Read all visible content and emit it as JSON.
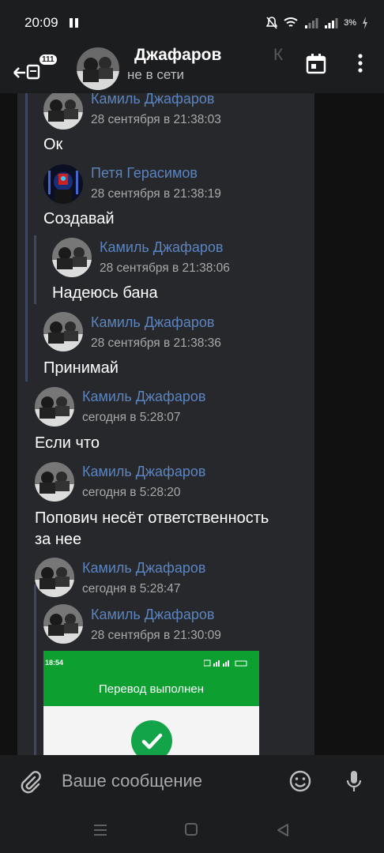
{
  "status_bar": {
    "time": "20:09",
    "battery": "3%"
  },
  "header": {
    "back_badge": "111",
    "title": "Джафаров",
    "title_ghost": "К",
    "subtitle": "не в сети",
    "calendar_icon": "calendar-icon",
    "more_icon": "more-vert-icon"
  },
  "messages": [
    {
      "author": "Камиль Джафаров",
      "time": "28 сентября в 21:38:03",
      "text": "Ок"
    },
    {
      "author": "Петя Герасимов",
      "time": "28 сентября в 21:38:19",
      "text": "Создавай"
    },
    {
      "author": "Камиль Джафаров",
      "time": "28 сентября в 21:38:06",
      "text": "Надеюсь бана"
    },
    {
      "author": "Камиль Джафаров",
      "time": "28 сентября в 21:38:36",
      "text": "Принимай"
    },
    {
      "author": "Камиль Джафаров",
      "time": "сегодня в 5:28:07",
      "text": "Если что"
    },
    {
      "author": "Камиль Джафаров",
      "time": "сегодня в 5:28:20",
      "text_line1": "Попович несёт ответственность",
      "text_line2": "за нее"
    },
    {
      "author": "Камиль Джафаров",
      "time": "сегодня в 5:28:47"
    },
    {
      "author": "Камиль Джафаров",
      "time": "28 сентября в 21:30:09"
    }
  ],
  "attachment": {
    "status_time": "18:54",
    "title": "Перевод выполнен"
  },
  "composer": {
    "placeholder": "Ваше сообщение"
  },
  "colors": {
    "author": "#5b84c0",
    "panel": "#26282b",
    "bar": "#3c4861",
    "success": "#0d9f2f"
  }
}
